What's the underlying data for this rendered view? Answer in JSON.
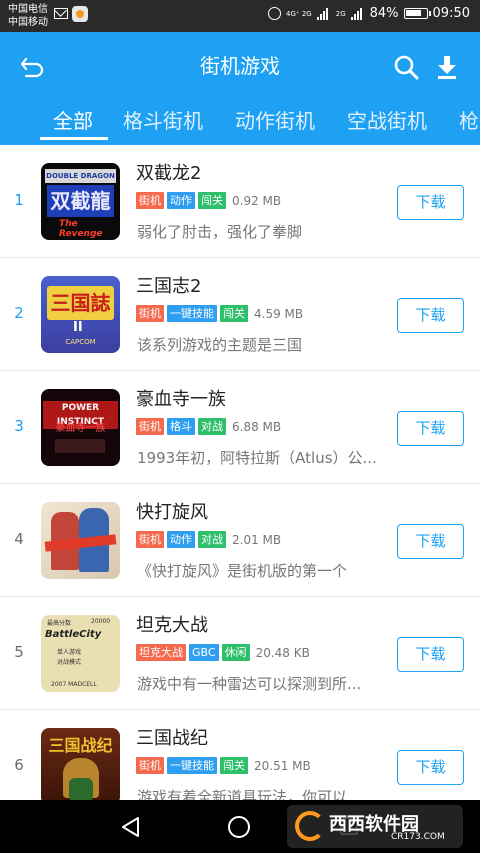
{
  "status_bar": {
    "carrier1": "中国电信",
    "carrier2": "中国移动",
    "net_top": "4G⁺ 2G",
    "net_bottom": "2G",
    "battery": "84%",
    "battery_level": 84,
    "time": "09:50"
  },
  "header": {
    "title": "街机游戏",
    "icons": [
      "back-icon",
      "search-icon",
      "download-icon"
    ]
  },
  "tabs": [
    {
      "label": "全部",
      "active": true
    },
    {
      "label": "格斗街机",
      "active": false
    },
    {
      "label": "动作街机",
      "active": false
    },
    {
      "label": "空战街机",
      "active": false
    },
    {
      "label": "枪",
      "active": false
    }
  ],
  "games": [
    {
      "rank": "1",
      "name": "双截龙2",
      "tags": [
        {
          "text": "街机",
          "color": "orange"
        },
        {
          "text": "动作",
          "color": "blue"
        },
        {
          "text": "闯关",
          "color": "green"
        }
      ],
      "size": "0.92 MB",
      "desc": "弱化了肘击，强化了拳脚",
      "download": "下载"
    },
    {
      "rank": "2",
      "name": "三国志2",
      "tags": [
        {
          "text": "街机",
          "color": "orange"
        },
        {
          "text": "一键技能",
          "color": "blue"
        },
        {
          "text": "闯关",
          "color": "green"
        }
      ],
      "size": "4.59 MB",
      "desc": "该系列游戏的主题是三国",
      "download": "下载"
    },
    {
      "rank": "3",
      "name": "豪血寺一族",
      "tags": [
        {
          "text": "街机",
          "color": "orange"
        },
        {
          "text": "格斗",
          "color": "blue"
        },
        {
          "text": "对战",
          "color": "green"
        }
      ],
      "size": "6.88 MB",
      "desc": "1993年初，阿特拉斯（Atlus）公...",
      "download": "下载"
    },
    {
      "rank": "4",
      "name": "快打旋风",
      "tags": [
        {
          "text": "街机",
          "color": "orange"
        },
        {
          "text": "动作",
          "color": "blue"
        },
        {
          "text": "对战",
          "color": "green"
        }
      ],
      "size": "2.01 MB",
      "desc": "《快打旋风》是街机版的第一个",
      "download": "下载"
    },
    {
      "rank": "5",
      "name": "坦克大战",
      "tags": [
        {
          "text": "坦克大战",
          "color": "orange"
        },
        {
          "text": "GBC",
          "color": "blue"
        },
        {
          "text": "休闲",
          "color": "green"
        }
      ],
      "size": "20.48 KB",
      "desc": " 游戏中有一种雷达可以探测到所...",
      "download": "下载"
    },
    {
      "rank": "6",
      "name": "三国战纪",
      "tags": [
        {
          "text": "街机",
          "color": "orange"
        },
        {
          "text": "一键技能",
          "color": "blue"
        },
        {
          "text": "闯关",
          "color": "green"
        }
      ],
      "size": "20.51 MB",
      "desc": " 游戏有着全新道具玩法，你可以...",
      "download": "下载"
    }
  ],
  "thumb_text": {
    "t1a": "DOUBLE DRAGON",
    "t1b": "双截龍",
    "t1c": "The Revenge",
    "t2a": "三国誌",
    "t2b": "II",
    "t2c": "CAPCOM",
    "t3a": "POWER INSTINCT",
    "t3b": "豪血寺一族",
    "t5a": "最高分数",
    "t5b": "20000",
    "t5c": "BattleCity",
    "t5d": "单人游戏",
    "t5e": "对战模式",
    "t5f": "2007 MADCELL",
    "t6a": "三国战纪"
  },
  "watermark": {
    "name": "西西软件园",
    "url": "CR173.COM"
  }
}
